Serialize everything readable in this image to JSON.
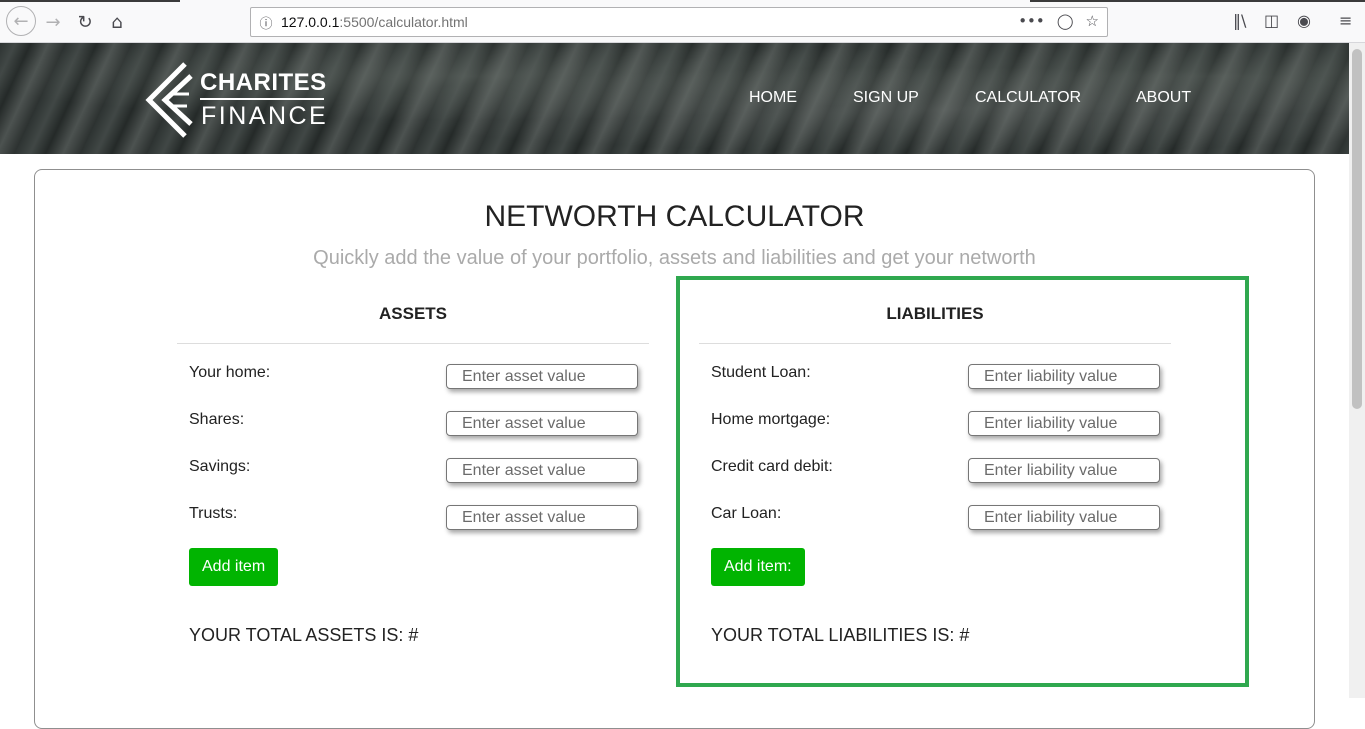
{
  "browser": {
    "url_host": "127.0.0.1",
    "url_rest": ":5500/calculator.html",
    "back_icon": "back-arrow-icon",
    "forward_icon": "forward-arrow-icon",
    "reload_icon": "reload-icon",
    "home_icon": "home-icon",
    "menu_dots": "•••"
  },
  "header": {
    "logo_line1": "CHARITES",
    "logo_line2": "FINANCE",
    "nav": [
      "HOME",
      "SIGN UP",
      "CALCULATOR",
      "ABOUT"
    ]
  },
  "page": {
    "title": "NETWORTH CALCULATOR",
    "subtitle": "Quickly add the value of your portfolio, assets and liabilities and get your networth"
  },
  "assets": {
    "heading": "ASSETS",
    "rows": [
      {
        "label": "Your home:",
        "placeholder": "Enter asset value"
      },
      {
        "label": "Shares:",
        "placeholder": "Enter asset value"
      },
      {
        "label": "Savings:",
        "placeholder": "Enter asset value"
      },
      {
        "label": "Trusts:",
        "placeholder": "Enter asset value"
      }
    ],
    "add_label": "Add item",
    "total_label": "YOUR TOTAL ASSETS IS: #"
  },
  "liabilities": {
    "heading": "LIABILITIES",
    "rows": [
      {
        "label": "Student Loan:",
        "placeholder": "Enter liability value"
      },
      {
        "label": "Home mortgage:",
        "placeholder": "Enter liability value"
      },
      {
        "label": "Credit card debit:",
        "placeholder": "Enter liability value"
      },
      {
        "label": "Car Loan:",
        "placeholder": "Enter liability value"
      }
    ],
    "add_label": "Add item:",
    "total_label": "YOUR TOTAL LIABILITIES IS: #"
  },
  "colors": {
    "button_green": "#01b401",
    "highlight_green": "#2fa84f"
  }
}
